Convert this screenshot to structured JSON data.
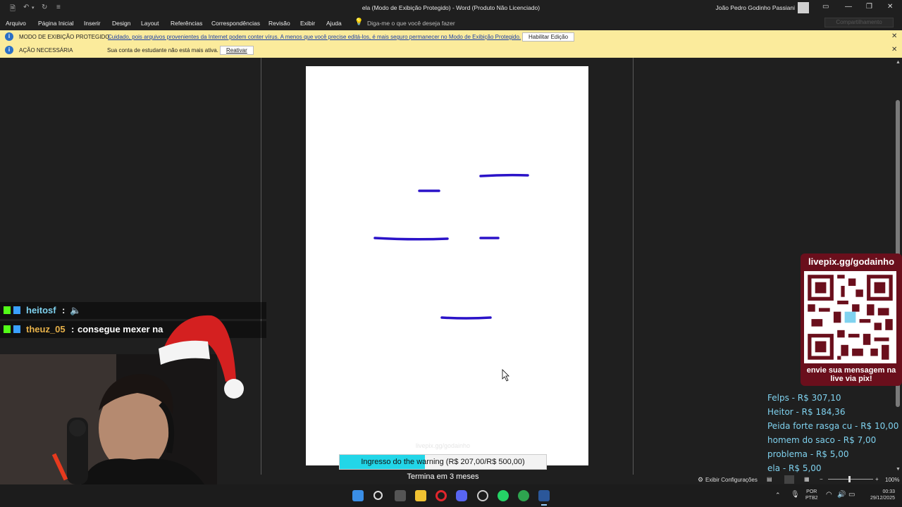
{
  "titlebar": {
    "title": "ela (Modo de Exibição Protegido)  -  Word (Produto Não Licenciado)",
    "user": "João Pedro Godinho Passiani"
  },
  "menu": {
    "items": [
      "Arquivo",
      "Página Inicial",
      "Inserir",
      "Design",
      "Layout",
      "Referências",
      "Correspondências",
      "Revisão",
      "Exibir",
      "Ajuda"
    ],
    "tell_me": "Diga-me o que você deseja fazer",
    "share": "Compartilhamento"
  },
  "infobar1": {
    "label": "MODO DE EXIBIÇÃO PROTEGIDO",
    "message": "Cuidado, pois arquivos provenientes da Internet podem conter vírus. A menos que você precise editá-los, é mais seguro permanecer no Modo de Exibição Protegido.",
    "button": "Habilitar Edição"
  },
  "infobar2": {
    "label": "AÇÃO NECESSÁRIA",
    "message": "Sua conta de estudante não está mais ativa.",
    "button": "Reativar"
  },
  "statusbar": {
    "settings": "Exibir Configurações",
    "zoom": "100%"
  },
  "taskbar": {
    "lang_line1": "POR",
    "lang_line2": "PTB2",
    "time": "00:33",
    "date": "29/12/2025",
    "apps": [
      "windows-start",
      "search",
      "task-view",
      "file-explorer",
      "opera",
      "discord",
      "chatgpt",
      "whatsapp",
      "edge",
      "word"
    ]
  },
  "chat": [
    {
      "user": "heitosf",
      "sep": ":",
      "message": "",
      "color": "#7fd2ef"
    },
    {
      "user": "theuz_05",
      "sep": ":",
      "message": "consegue mexer na",
      "color": "#e8b24a"
    }
  ],
  "qr": {
    "url": "livepix.gg/godainho",
    "message_line1": "envie sua mensagem na",
    "message_line2": "live via pix!"
  },
  "donations": [
    "Felps - R$ 307,10",
    "Heitor - R$ 184,36",
    "Peida forte rasga cu - R$ 10,00",
    "homem do saco - R$ 7,00",
    "problema - R$ 5,00",
    "ela - R$ 5,00"
  ],
  "goal": {
    "label": "Ingresso do the warning (R$ 207,00/R$ 500,00)",
    "progress": 0.414,
    "ends": "Termina em 3 meses",
    "watermark": "livepix.gg/godainho"
  },
  "colors": {
    "pen": "#2a12c8",
    "infobar": "#fbeb9c",
    "goal_fill": "#22d6e8",
    "donation_text": "#7fd2ef"
  }
}
